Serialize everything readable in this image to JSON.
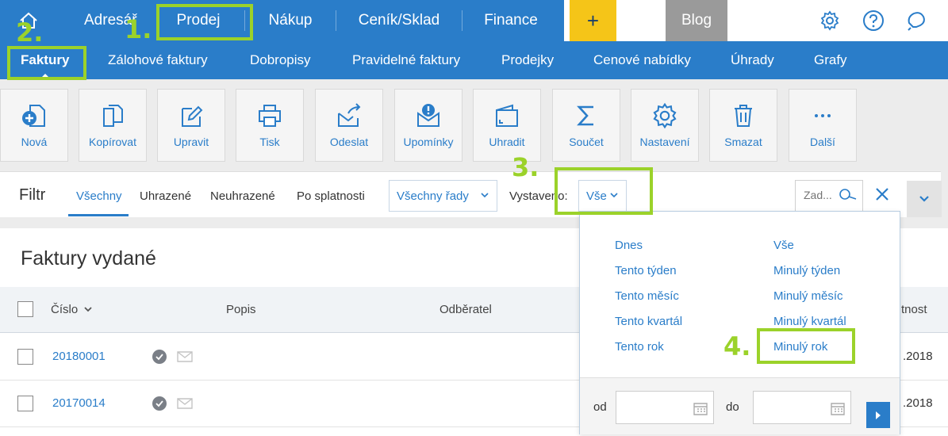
{
  "topnav": {
    "items": [
      "Adresář",
      "Prodej",
      "Nákup",
      "Ceník/Sklad",
      "Finance"
    ],
    "plus_label": "+",
    "blog_label": "Blog"
  },
  "subnav": {
    "items": [
      "Faktury",
      "Zálohové faktury",
      "Dobropisy",
      "Pravidelné faktury",
      "Prodejky",
      "Cenové nabídky",
      "Úhrady",
      "Grafy"
    ]
  },
  "toolbar": {
    "items": [
      {
        "label": "Nová",
        "icon": "new-document-icon"
      },
      {
        "label": "Kopírovat",
        "icon": "copy-icon"
      },
      {
        "label": "Upravit",
        "icon": "edit-icon"
      },
      {
        "label": "Tisk",
        "icon": "print-icon"
      },
      {
        "label": "Odeslat",
        "icon": "send-icon"
      },
      {
        "label": "Upomínky",
        "icon": "reminder-icon"
      },
      {
        "label": "Uhradit",
        "icon": "wallet-icon"
      },
      {
        "label": "Součet",
        "icon": "sum-icon"
      },
      {
        "label": "Nastavení",
        "icon": "gear-icon"
      },
      {
        "label": "Smazat",
        "icon": "trash-icon"
      },
      {
        "label": "Další",
        "icon": "more-icon"
      }
    ]
  },
  "filter": {
    "title": "Filtr",
    "tabs": [
      "Všechny",
      "Uhrazené",
      "Neuhrazené",
      "Po splatnosti"
    ],
    "series_select": "Všechny řady",
    "issued_label": "Vystaveno:",
    "issued_select": "Vše",
    "search_placeholder": "Zad..."
  },
  "content": {
    "title": "Faktury vydané",
    "columns": {
      "number": "Číslo",
      "description": "Popis",
      "customer": "Odběratel",
      "due": "tnost"
    },
    "rows": [
      {
        "number": "20180001",
        "date": ".2018"
      },
      {
        "number": "20170014",
        "date": ".2018"
      }
    ]
  },
  "dropdown": {
    "left": [
      "Dnes",
      "Tento týden",
      "Tento měsíc",
      "Tento kvartál",
      "Tento rok"
    ],
    "right": [
      "Vše",
      "Minulý týden",
      "Minulý měsíc",
      "Minulý kvartál",
      "Minulý rok"
    ],
    "from_label": "od",
    "to_label": "do"
  },
  "annotations": {
    "step1": "1.",
    "step2": "2.",
    "step3": "3.",
    "step4": "4."
  },
  "colors": {
    "brand_blue": "#2a7dc9",
    "highlight_green": "#9bd22a",
    "plus_yellow": "#f5c518"
  }
}
